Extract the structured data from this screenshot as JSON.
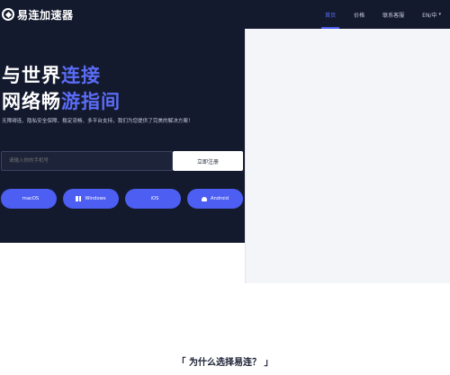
{
  "brand": {
    "name": "易连加速器"
  },
  "nav": {
    "items": [
      {
        "label": "首页",
        "active": true
      },
      {
        "label": "价格",
        "active": false
      },
      {
        "label": "联系客服",
        "active": false
      },
      {
        "label": "EN/中",
        "active": false
      }
    ]
  },
  "hero": {
    "line1_plain": "与世界",
    "line1_accent": "连接",
    "line2_plain": "网络畅",
    "line2_accent": "游指间",
    "subtitle": "无障碍连、隐私安全保障、稳定流畅、多平台支持，我们为您提供了完美的解决方案！",
    "phone_placeholder": "请输入你的手机号",
    "register_label": "立即注册"
  },
  "platforms": [
    {
      "label": "macOS",
      "icon": "apple-icon"
    },
    {
      "label": "Windows",
      "icon": "windows-icon"
    },
    {
      "label": "iOS",
      "icon": "apple-icon"
    },
    {
      "label": "Android",
      "icon": "android-icon"
    }
  ],
  "section": {
    "title": "「 为什么选择易连？ 」"
  },
  "colors": {
    "hero_bg": "#141a2e",
    "accent": "#5a6cf6",
    "button": "#4d5ef2"
  }
}
